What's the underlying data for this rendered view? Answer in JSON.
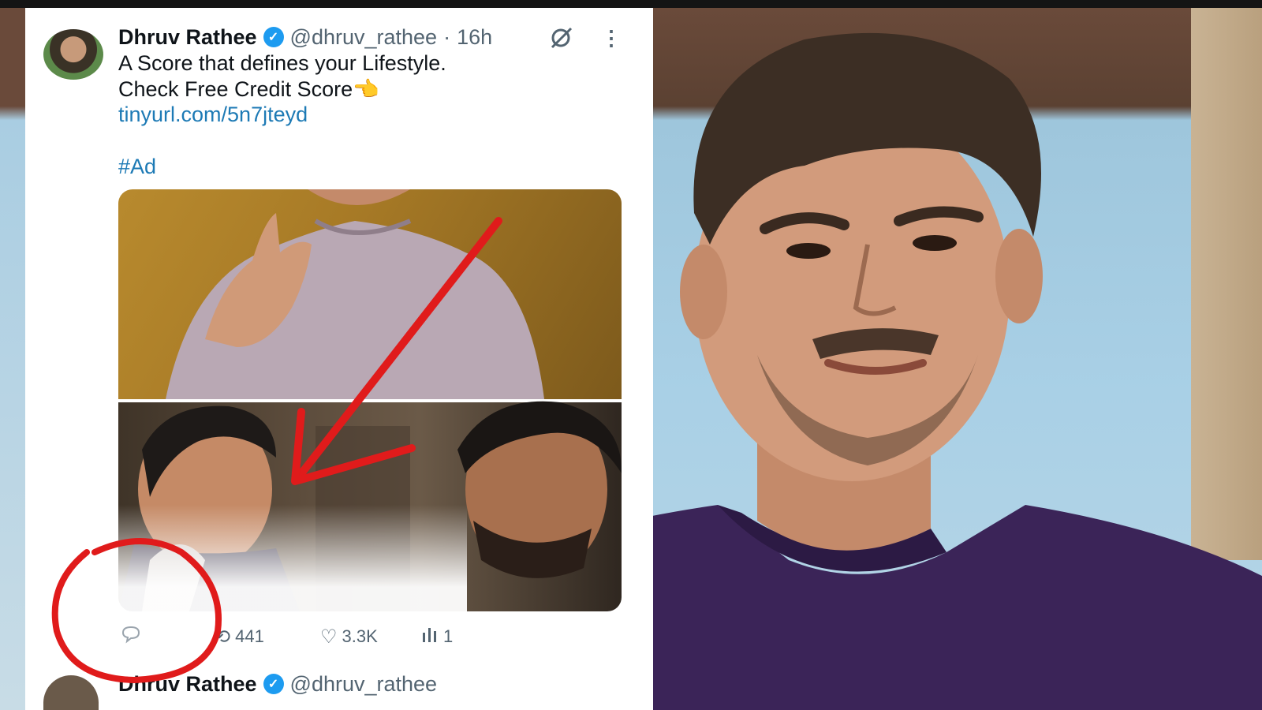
{
  "tweet": {
    "display_name": "Dhruv Rathee",
    "verified_icon": "verified-badge-icon",
    "handle": "@dhruv_rathee",
    "separator": "·",
    "time": "16h",
    "text_line1": "A Score that defines your Lifestyle.",
    "text_line2": "Check Free Credit Score",
    "pointing_emoji": "👈",
    "link": "tinyurl.com/5n7jteyd",
    "hashtag": "#Ad",
    "actions": {
      "reply_icon": "reply-icon",
      "retweet_icon": "retweet-icon",
      "retweets": "441",
      "like_icon": "heart-icon",
      "likes": "3.3K",
      "views_icon": "views-icon",
      "views": "1"
    }
  },
  "next_tweet": {
    "display_name": "Dhruv Rathee",
    "handle": "@dhruv_rathee"
  },
  "colors": {
    "link": "#1d7ab5",
    "verified": "#1d9bf0",
    "annotation": "#e01b1b",
    "muted_text": "#536471"
  }
}
